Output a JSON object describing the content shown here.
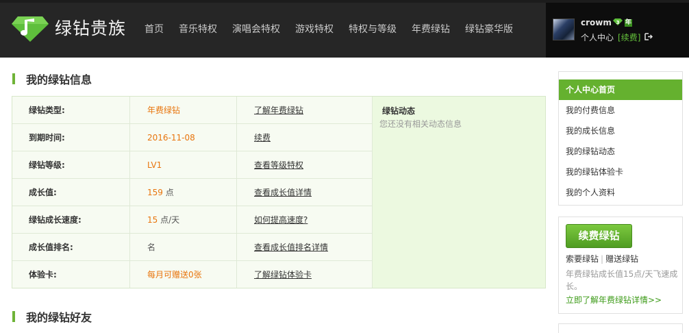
{
  "brand": {
    "name": "绿钻贵族",
    "logo_icon": "green-diamond-music-note-icon",
    "accent_color": "#65b12f",
    "header_bg": "#262626"
  },
  "nav": [
    "首页",
    "音乐特权",
    "演唱会特权",
    "游戏特权",
    "特权与等级",
    "年费绿钻",
    "绿钻豪华版"
  ],
  "user": {
    "name": "crowm",
    "badge_level": "3",
    "badge_year": "年",
    "center_link": "个人中心",
    "renew_link": "[续费]"
  },
  "info_section": {
    "title": "我的绿钻信息",
    "rows": [
      {
        "label": "绿钻类型:",
        "value": "年费绿钻",
        "unit": "",
        "link": "了解年费绿钻"
      },
      {
        "label": "到期时间:",
        "value": "2016-11-08",
        "unit": "",
        "link": "续费"
      },
      {
        "label": "绿钻等级:",
        "value": "LV1",
        "unit": "",
        "link": "查看等级特权"
      },
      {
        "label": "成长值:",
        "value": "159",
        "unit": " 点",
        "link": "查看成长值详情"
      },
      {
        "label": "绿钻成长速度:",
        "value": "15",
        "unit": " 点/天",
        "link": "如何提高速度?"
      },
      {
        "label": "成长值排名:",
        "value": "",
        "unit": "名",
        "link": "查看成长值排名详情"
      },
      {
        "label": "体验卡:",
        "value": "每月可赠送0张",
        "unit": "",
        "link": "了解绿钻体验卡"
      }
    ],
    "news_title": "绿钻动态",
    "news_empty": "您还没有相关动态信息"
  },
  "friends_section": {
    "title": "我的绿钻好友"
  },
  "sidebar": {
    "items": [
      "个人中心首页",
      "我的付费信息",
      "我的成长信息",
      "我的绿钻动态",
      "我的绿钻体验卡",
      "我的个人资料"
    ],
    "renew_button": "续费绿钻",
    "ask_link": "索要绿钻",
    "gift_link": "赠送绿钻",
    "separator": "|",
    "desc": "年费绿钻成长值15点/天飞速成长。",
    "more_link": "立即了解年费绿钻详情>>"
  }
}
